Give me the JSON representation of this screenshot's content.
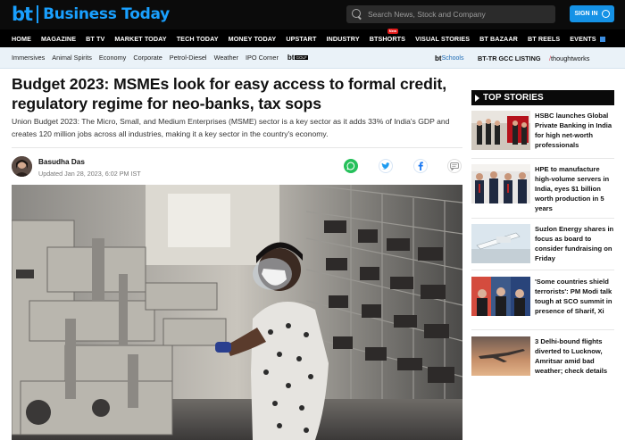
{
  "brand": {
    "logo_short": "bt",
    "logo_name": "Business Today"
  },
  "search": {
    "placeholder": "Search News, Stock and Company"
  },
  "signin": {
    "label": "SIGN IN"
  },
  "main_nav": {
    "items": [
      "HOME",
      "MAGAZINE",
      "BT TV",
      "MARKET TODAY",
      "TECH TODAY",
      "MONEY TODAY",
      "UPSTART",
      "INDUSTRY",
      "BTSHORTS",
      "VISUAL STORIES",
      "BT BAZAAR",
      "BT REELS",
      "EVENTS"
    ],
    "new_badge": "New"
  },
  "sub_nav": {
    "items": [
      "Immersives",
      "Animal Spirits",
      "Economy",
      "Corporate",
      "Petrol-Diesel",
      "Weather",
      "IPO Corner"
    ],
    "golf": {
      "bt": "bt",
      "tag": "GOLF"
    },
    "schools": {
      "bt": "bt",
      "label": "Schools"
    },
    "bttr": "BT-TR GCC LISTING",
    "thoughtworks": {
      "slash": "/",
      "name": "thoughtworks"
    }
  },
  "article": {
    "headline": "Budget 2023: MSMEs look for easy access to formal credit, regulatory regime for neo-banks, tax sops",
    "summary": "Union Budget 2023: The Micro, Small, and Medium Enterprises (MSME) sector is a key sector as it adds 33% of India's GDP and creates 120 million jobs across all industries, making it a key sector in the country's economy.",
    "author": "Basudha Das",
    "updated": "Updated Jan 28, 2023, 6:02 PM IST",
    "share_icons": [
      "whatsapp-icon",
      "twitter-icon",
      "facebook-icon",
      "comment-icon"
    ]
  },
  "top_stories": {
    "heading": "TOP STORIES",
    "items": [
      {
        "title": "HSBC launches Global Private Banking in India for high net-worth professionals"
      },
      {
        "title": "HPE to manufacture high-volume servers in India, eyes $1 billion worth production in 5 years"
      },
      {
        "title": "Suzlon Energy shares in focus as board to consider fundraising on Friday"
      },
      {
        "title": "'Some countries shield terrorists': PM Modi talk tough at SCO summit in presence of Sharif, Xi"
      },
      {
        "title": "3 Delhi-bound flights diverted to Lucknow, Amritsar amid bad weather; check details"
      }
    ]
  },
  "colors": {
    "brand_blue": "#19a0ff",
    "signin_blue": "#1592e6",
    "nav_black": "#000000",
    "subnav_bg": "#eaf2f8"
  }
}
